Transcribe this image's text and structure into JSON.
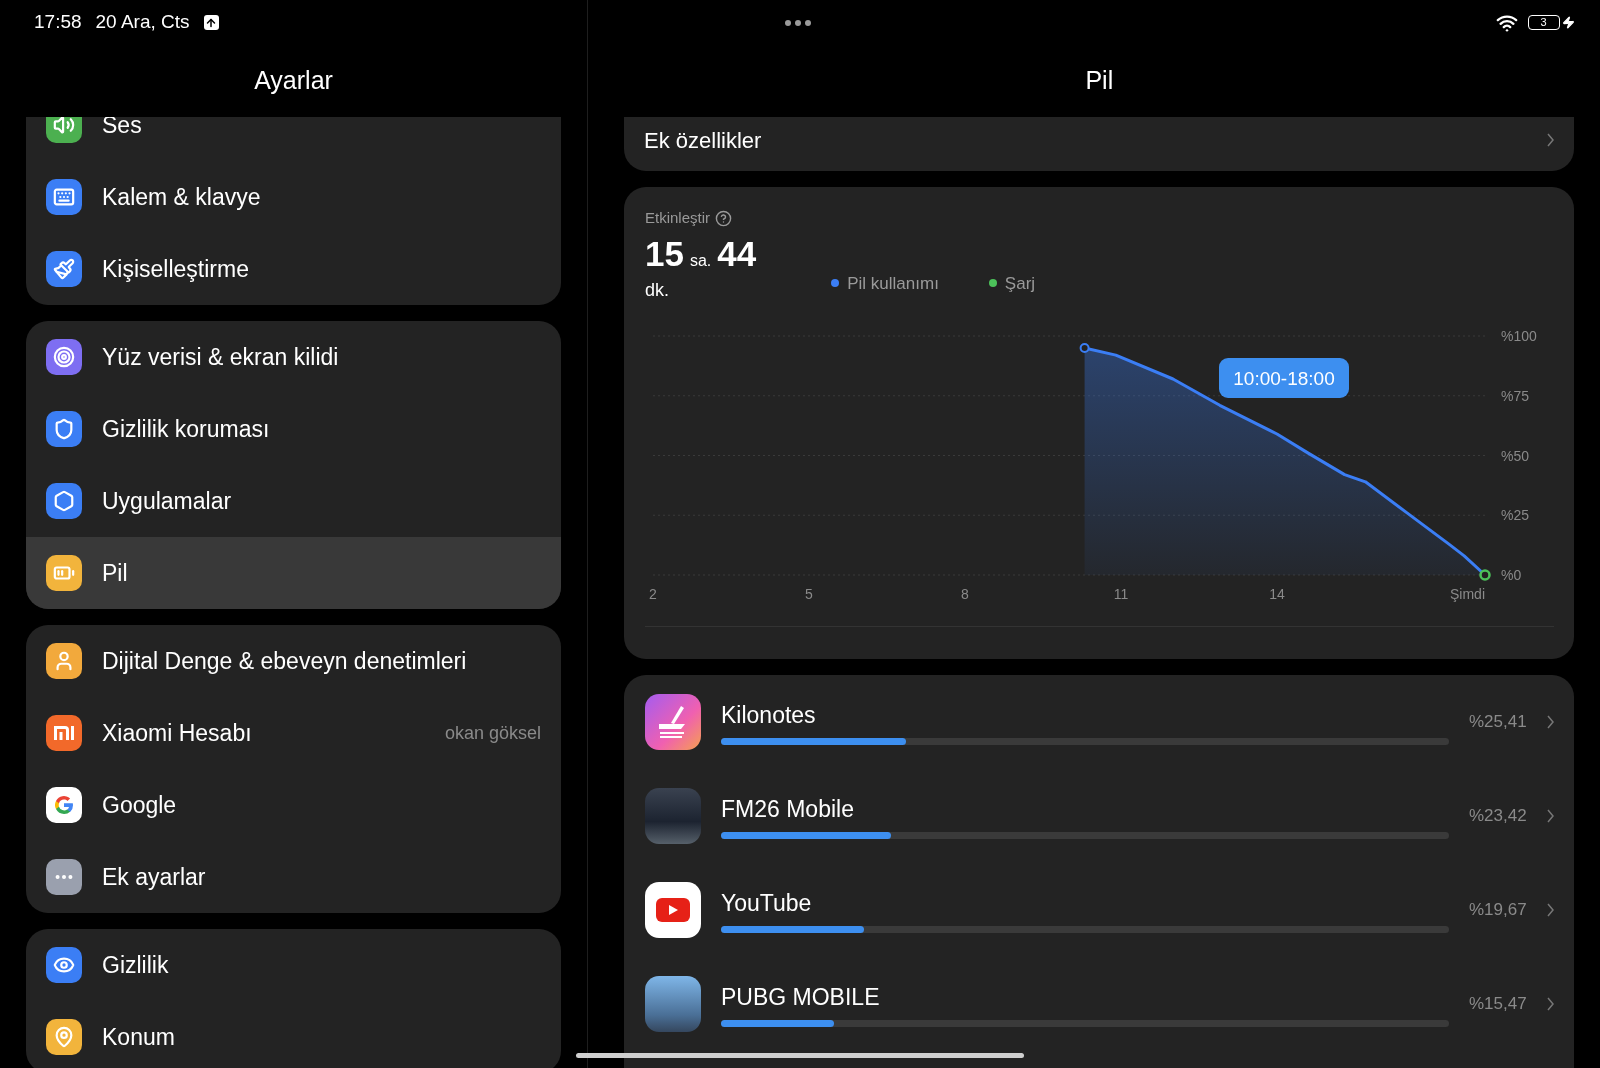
{
  "status_bar": {
    "time": "17:58",
    "date": "20 Ara, Cts",
    "battery_text": "3"
  },
  "left_panel": {
    "title": "Ayarlar",
    "groups": [
      {
        "items": [
          {
            "label": "Ses",
            "selected": false
          },
          {
            "label": "Kalem & klavye",
            "selected": false
          },
          {
            "label": "Kişiselleştirme",
            "selected": false
          }
        ]
      },
      {
        "items": [
          {
            "label": "Yüz verisi & ekran kilidi",
            "selected": false
          },
          {
            "label": "Gizlilik koruması",
            "selected": false
          },
          {
            "label": "Uygulamalar",
            "selected": false
          },
          {
            "label": "Pil",
            "selected": true
          }
        ]
      },
      {
        "items": [
          {
            "label": "Dijital Denge & ebeveyn denetimleri",
            "selected": false
          },
          {
            "label": "Xiaomi Hesabı",
            "value": "okan göksel",
            "selected": false
          },
          {
            "label": "Google",
            "selected": false
          },
          {
            "label": "Ek ayarlar",
            "selected": false
          }
        ]
      },
      {
        "items": [
          {
            "label": "Gizlilik",
            "selected": false
          },
          {
            "label": "Konum",
            "selected": false
          }
        ]
      }
    ]
  },
  "right_panel": {
    "title": "Pil",
    "top_row": {
      "label": "Ek özellikler"
    },
    "usage_card": {
      "header": "Etkinleştir",
      "charge_legend": {
        "label": "Şarj",
        "color": "#4cc25a"
      },
      "hours": "15",
      "hours_unit": "sa.",
      "minutes": "44",
      "minutes_unit": "dk.",
      "chart_data": {
        "type": "area",
        "x": [
          10.3,
          10.9,
          12,
          12.9,
          14,
          14.6,
          15.3,
          15.7,
          16.5,
          17.3,
          17.6,
          18
        ],
        "series": [
          {
            "name": "Pil kullanımı",
            "color": "#3b7ef5",
            "values": [
              95,
              92,
              82,
              71,
              59,
              51,
              42,
              39,
              26,
              13,
              8,
              0
            ]
          }
        ],
        "grid": true,
        "xlim": [
          2,
          18
        ],
        "ylim": [
          0,
          100
        ],
        "xticks": [
          2,
          5,
          8,
          11,
          14,
          {
            "value": 18,
            "label": "Şimdi"
          }
        ],
        "yticks": [
          {
            "value": 100,
            "label": "%100"
          },
          {
            "value": 75,
            "label": "%75"
          },
          {
            "value": 50,
            "label": "%50"
          },
          {
            "value": 25,
            "label": "%25"
          },
          {
            "value": 0,
            "label": "%0"
          }
        ],
        "annotations": [
          "10:00-18:00"
        ]
      }
    },
    "apps": [
      {
        "name": "Kilonotes",
        "percent": "%25,41",
        "level": 0.254
      },
      {
        "name": "FM26 Mobile",
        "percent": "%23,42",
        "level": 0.234
      },
      {
        "name": "YouTube",
        "percent": "%19,67",
        "level": 0.197
      },
      {
        "name": "PUBG MOBILE",
        "percent": "%15,47",
        "level": 0.155
      }
    ]
  }
}
